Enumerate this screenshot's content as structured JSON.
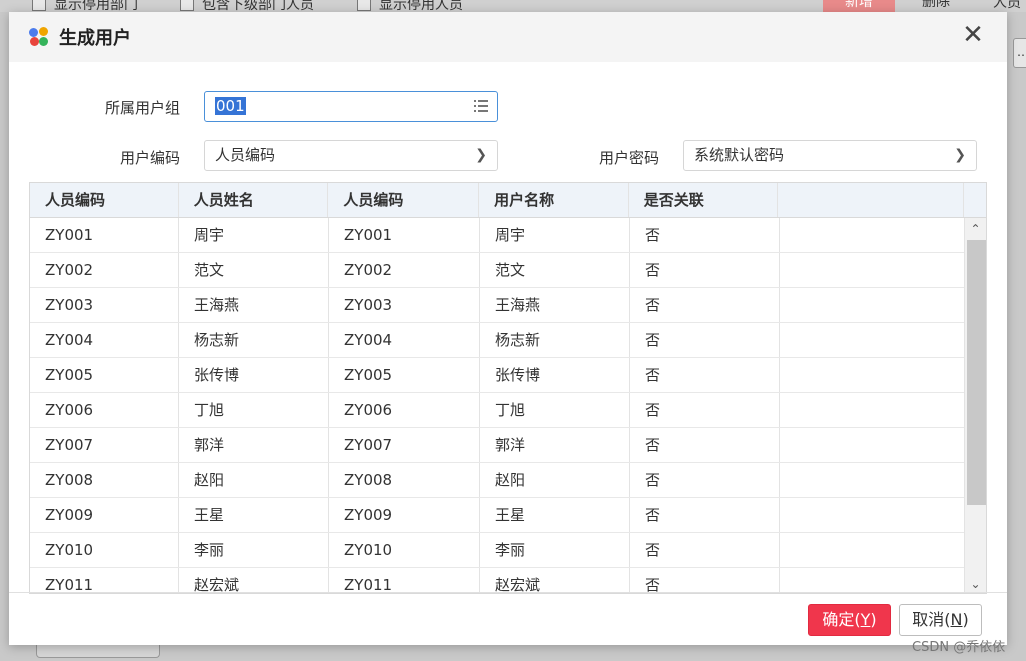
{
  "background": {
    "checks": [
      "显示停用部门",
      "包含下级部门人员",
      "显示停用人员"
    ],
    "add_button": "新增",
    "delete_button": "删除",
    "extra_text": "人员",
    "side_button": "…"
  },
  "dialog": {
    "title": "生成用户",
    "close_glyph": "✕"
  },
  "form": {
    "group_label": "所属用户组",
    "group_value": "001",
    "code_label": "用户编码",
    "code_value": "人员编码",
    "password_label": "用户密码",
    "password_value": "系统默认密码"
  },
  "table": {
    "columns": [
      "人员编码",
      "人员姓名",
      "人员编码",
      "用户名称",
      "是否关联",
      ""
    ],
    "rows": [
      [
        "ZY001",
        "周宇",
        "ZY001",
        "周宇",
        "否"
      ],
      [
        "ZY002",
        "范文",
        "ZY002",
        "范文",
        "否"
      ],
      [
        "ZY003",
        "王海燕",
        "ZY003",
        "王海燕",
        "否"
      ],
      [
        "ZY004",
        "杨志新",
        "ZY004",
        "杨志新",
        "否"
      ],
      [
        "ZY005",
        "张传博",
        "ZY005",
        "张传博",
        "否"
      ],
      [
        "ZY006",
        "丁旭",
        "ZY006",
        "丁旭",
        "否"
      ],
      [
        "ZY007",
        "郭洋",
        "ZY007",
        "郭洋",
        "否"
      ],
      [
        "ZY008",
        "赵阳",
        "ZY008",
        "赵阳",
        "否"
      ],
      [
        "ZY009",
        "王星",
        "ZY009",
        "王星",
        "否"
      ],
      [
        "ZY010",
        "李丽",
        "ZY010",
        "李丽",
        "否"
      ],
      [
        "ZY011",
        "赵宏斌",
        "ZY011",
        "赵宏斌",
        "否"
      ]
    ]
  },
  "footer": {
    "ok_label": "确定",
    "ok_key": "Y",
    "cancel_label": "取消",
    "cancel_key": "N"
  },
  "watermark": "CSDN @乔依依",
  "colors": {
    "ok_button": "#f0364c",
    "header_bg": "#eef3f9",
    "selection": "#3574d6"
  }
}
